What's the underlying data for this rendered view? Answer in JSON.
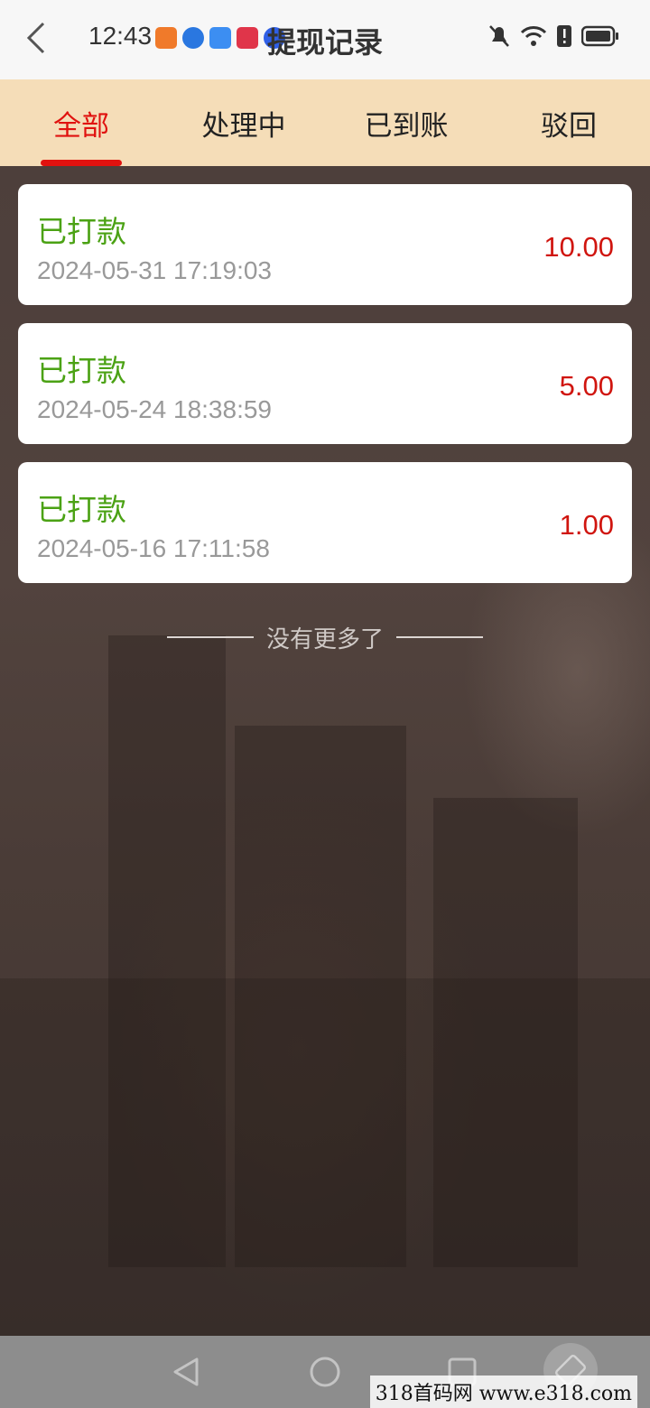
{
  "status_bar": {
    "time": "12:43",
    "notification_icons": [
      "app-orange-icon",
      "app-blue-globe-icon",
      "cloud-icon",
      "book-icon",
      "lightbulb-icon"
    ],
    "right_icons": [
      "mute-bell-icon",
      "wifi-icon",
      "alert-icon",
      "battery-icon"
    ]
  },
  "header": {
    "title": "提现记录",
    "back_icon": "chevron-left-icon"
  },
  "tabs": [
    {
      "label": "全部",
      "active": true
    },
    {
      "label": "处理中",
      "active": false
    },
    {
      "label": "已到账",
      "active": false
    },
    {
      "label": "驳回",
      "active": false
    }
  ],
  "records": [
    {
      "status": "已打款",
      "date": "2024-05-31 17:19:03",
      "amount": "10.00"
    },
    {
      "status": "已打款",
      "date": "2024-05-24 18:38:59",
      "amount": "5.00"
    },
    {
      "status": "已打款",
      "date": "2024-05-16 17:11:58",
      "amount": "1.00"
    }
  ],
  "list_end_text": "没有更多了",
  "watermark": "318首码网 www.e318.com",
  "colors": {
    "tab_bar_bg": "#f5ddb8",
    "active_tab": "#e0120f",
    "status_green": "#4ba214",
    "amount_red": "#d0150f"
  }
}
